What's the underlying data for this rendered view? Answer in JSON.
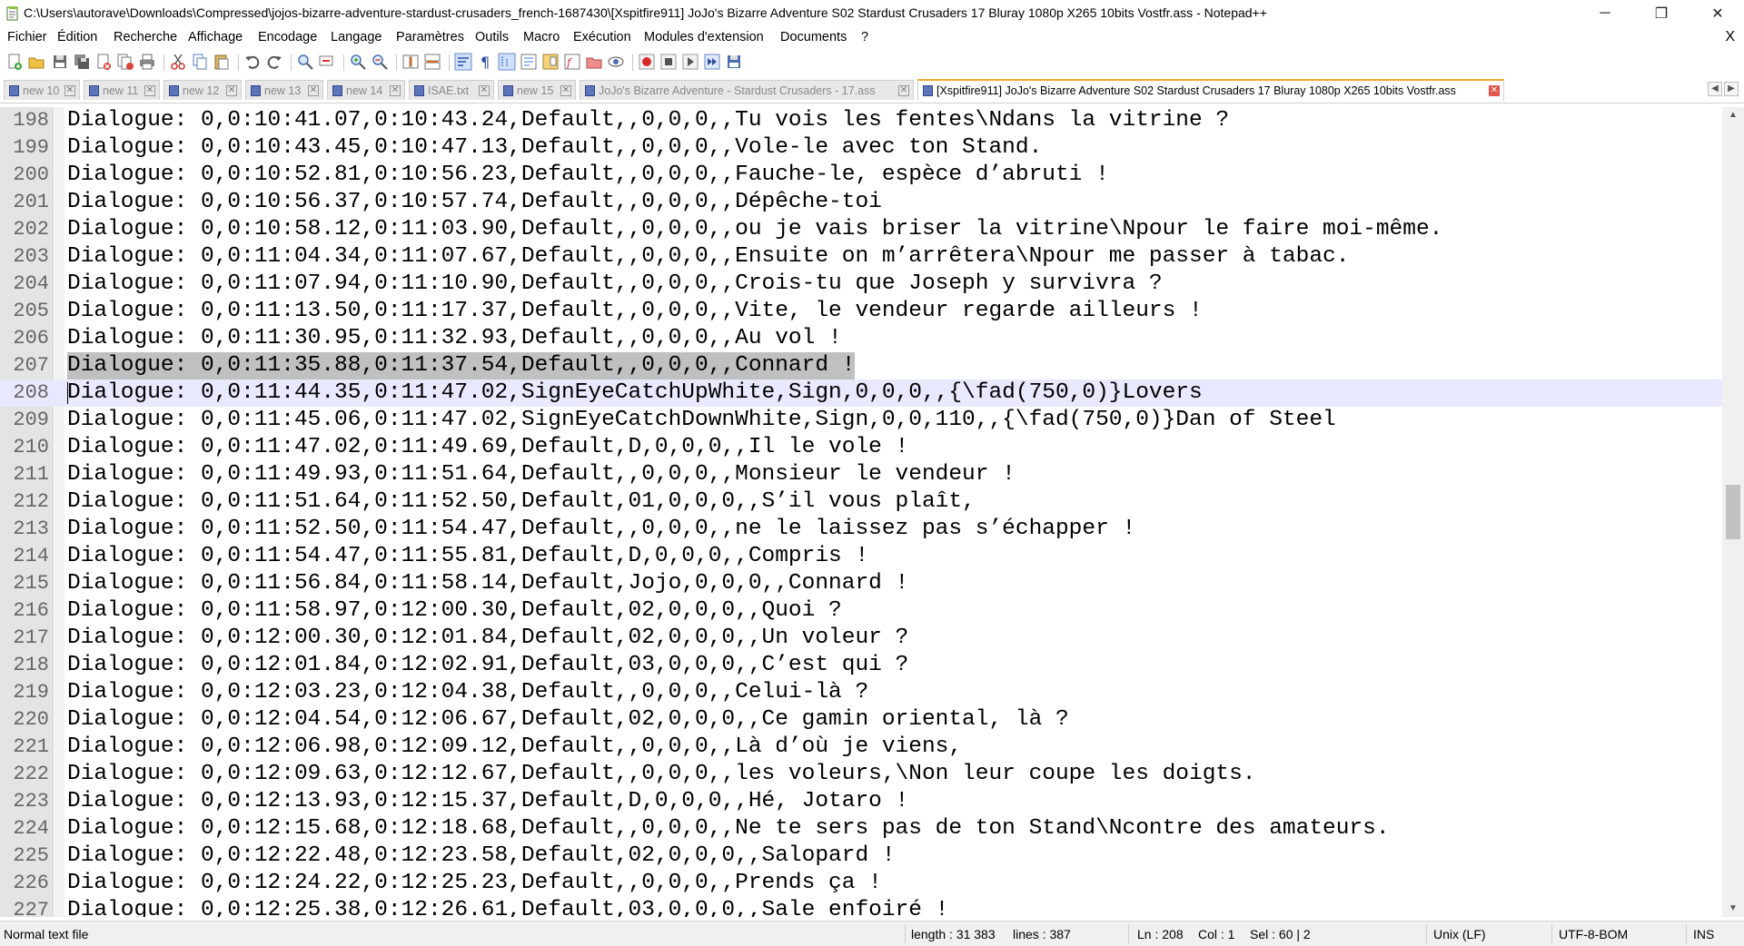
{
  "window": {
    "title": "C:\\Users\\autorave\\Downloads\\Compressed\\jojos-bizarre-adventure-stardust-crusaders_french-1687430\\[Xspitfire911] JoJo's Bizarre Adventure S02 Stardust Crusaders 17 Bluray 1080p X265 10bits Vostfr.ass - Notepad++",
    "minimize": "─",
    "maximize": "❐",
    "close": "✕"
  },
  "menu": {
    "items": [
      "Fichier",
      "Édition",
      "Recherche",
      "Affichage",
      "Encodage",
      "Langage",
      "Paramètres",
      "Outils",
      "Macro",
      "Exécution",
      "Modules d'extension",
      "Documents",
      "?"
    ],
    "close_doc": "X"
  },
  "tabs": [
    {
      "label": "new 10"
    },
    {
      "label": "new 11"
    },
    {
      "label": "new 12"
    },
    {
      "label": "new 13"
    },
    {
      "label": "new 14"
    },
    {
      "label": "ISAE.txt"
    },
    {
      "label": "new 15"
    },
    {
      "label": "JoJo's Bizarre Adventure - Stardust Crusaders - 17.ass"
    },
    {
      "label": "[Xspitfire911] JoJo's Bizarre Adventure S02 Stardust Crusaders 17 Bluray 1080p X265 10bits Vostfr.ass"
    }
  ],
  "tab_nav": {
    "left": "◀",
    "right": "▶",
    "close": "✕"
  },
  "editor": {
    "lines": [
      {
        "n": "198",
        "t": "Dialogue: 0,0:10:41.07,0:10:43.24,Default,,0,0,0,,Tu vois les fentes\\Ndans la vitrine ?"
      },
      {
        "n": "199",
        "t": "Dialogue: 0,0:10:43.45,0:10:47.13,Default,,0,0,0,,Vole-le avec ton Stand."
      },
      {
        "n": "200",
        "t": "Dialogue: 0,0:10:52.81,0:10:56.23,Default,,0,0,0,,Fauche-le, espèce d’abruti !"
      },
      {
        "n": "201",
        "t": "Dialogue: 0,0:10:56.37,0:10:57.74,Default,,0,0,0,,Dépêche-toi"
      },
      {
        "n": "202",
        "t": "Dialogue: 0,0:10:58.12,0:11:03.90,Default,,0,0,0,,ou je vais briser la vitrine\\Npour le faire moi-même."
      },
      {
        "n": "203",
        "t": "Dialogue: 0,0:11:04.34,0:11:07.67,Default,,0,0,0,,Ensuite on m’arrêtera\\Npour me passer à tabac."
      },
      {
        "n": "204",
        "t": "Dialogue: 0,0:11:07.94,0:11:10.90,Default,,0,0,0,,Crois-tu que Joseph y survivra ?"
      },
      {
        "n": "205",
        "t": "Dialogue: 0,0:11:13.50,0:11:17.37,Default,,0,0,0,,Vite, le vendeur regarde ailleurs !"
      },
      {
        "n": "206",
        "t": "Dialogue: 0,0:11:30.95,0:11:32.93,Default,,0,0,0,,Au vol !"
      },
      {
        "n": "207",
        "t": "Dialogue: 0,0:11:35.88,0:11:37.54,Default,,0,0,0,,Connard !",
        "selected": true
      },
      {
        "n": "208",
        "t": "Dialogue: 0,0:11:44.35,0:11:47.02,SignEyeCatchUpWhite,Sign,0,0,0,,{\\fad(750,0)}Lovers",
        "current": true
      },
      {
        "n": "209",
        "t": "Dialogue: 0,0:11:45.06,0:11:47.02,SignEyeCatchDownWhite,Sign,0,0,110,,{\\fad(750,0)}Dan of Steel"
      },
      {
        "n": "210",
        "t": "Dialogue: 0,0:11:47.02,0:11:49.69,Default,D,0,0,0,,Il le vole !"
      },
      {
        "n": "211",
        "t": "Dialogue: 0,0:11:49.93,0:11:51.64,Default,,0,0,0,,Monsieur le vendeur !"
      },
      {
        "n": "212",
        "t": "Dialogue: 0,0:11:51.64,0:11:52.50,Default,01,0,0,0,,S’il vous plaît,"
      },
      {
        "n": "213",
        "t": "Dialogue: 0,0:11:52.50,0:11:54.47,Default,,0,0,0,,ne le laissez pas s’échapper !"
      },
      {
        "n": "214",
        "t": "Dialogue: 0,0:11:54.47,0:11:55.81,Default,D,0,0,0,,Compris !"
      },
      {
        "n": "215",
        "t": "Dialogue: 0,0:11:56.84,0:11:58.14,Default,Jojo,0,0,0,,Connard !"
      },
      {
        "n": "216",
        "t": "Dialogue: 0,0:11:58.97,0:12:00.30,Default,02,0,0,0,,Quoi ?"
      },
      {
        "n": "217",
        "t": "Dialogue: 0,0:12:00.30,0:12:01.84,Default,02,0,0,0,,Un voleur ?"
      },
      {
        "n": "218",
        "t": "Dialogue: 0,0:12:01.84,0:12:02.91,Default,03,0,0,0,,C’est qui ?"
      },
      {
        "n": "219",
        "t": "Dialogue: 0,0:12:03.23,0:12:04.38,Default,,0,0,0,,Celui-là ?"
      },
      {
        "n": "220",
        "t": "Dialogue: 0,0:12:04.54,0:12:06.67,Default,02,0,0,0,,Ce gamin oriental, là ?"
      },
      {
        "n": "221",
        "t": "Dialogue: 0,0:12:06.98,0:12:09.12,Default,,0,0,0,,Là d’où je viens,"
      },
      {
        "n": "222",
        "t": "Dialogue: 0,0:12:09.63,0:12:12.67,Default,,0,0,0,,les voleurs,\\Non leur coupe les doigts."
      },
      {
        "n": "223",
        "t": "Dialogue: 0,0:12:13.93,0:12:15.37,Default,D,0,0,0,,Hé, Jotaro !"
      },
      {
        "n": "224",
        "t": "Dialogue: 0,0:12:15.68,0:12:18.68,Default,,0,0,0,,Ne te sers pas de ton Stand\\Ncontre des amateurs."
      },
      {
        "n": "225",
        "t": "Dialogue: 0,0:12:22.48,0:12:23.58,Default,02,0,0,0,,Salopard !"
      },
      {
        "n": "226",
        "t": "Dialogue: 0,0:12:24.22,0:12:25.23,Default,,0,0,0,,Prends ça !"
      },
      {
        "n": "227",
        "t": "Dialogue: 0,0:12:25.38,0:12:26.61,Default,03,0,0,0,,Sale enfoiré !"
      }
    ]
  },
  "scrollbar": {
    "up": "▲",
    "down": "▼",
    "position": 0.5
  },
  "status": {
    "file_type": "Normal text file",
    "length": "length : 31 383",
    "lines": "lines : 387",
    "ln": "Ln : 208",
    "col": "Col : 1",
    "sel": "Sel : 60 | 2",
    "eol": "Unix (LF)",
    "encoding": "UTF-8-BOM",
    "mode": "INS"
  },
  "toolbar_icons": [
    "new-file-icon",
    "open-file-icon",
    "save-icon",
    "save-all-icon",
    "close-icon",
    "close-all-icon",
    "print-icon",
    "cut-icon",
    "copy-icon",
    "paste-icon",
    "undo-icon",
    "redo-icon",
    "find-icon",
    "replace-icon",
    "zoom-in-icon",
    "zoom-out-icon",
    "sync-vertical-icon",
    "sync-horizontal-icon",
    "word-wrap-icon",
    "show-all-chars-icon",
    "indent-guide-icon",
    "udl-icon",
    "document-map-icon",
    "function-list-icon",
    "folder-workspace-icon",
    "monitoring-icon",
    "record-macro-icon",
    "stop-record-icon",
    "play-macro-icon",
    "run-macro-multiple-icon",
    "save-macro-icon"
  ]
}
